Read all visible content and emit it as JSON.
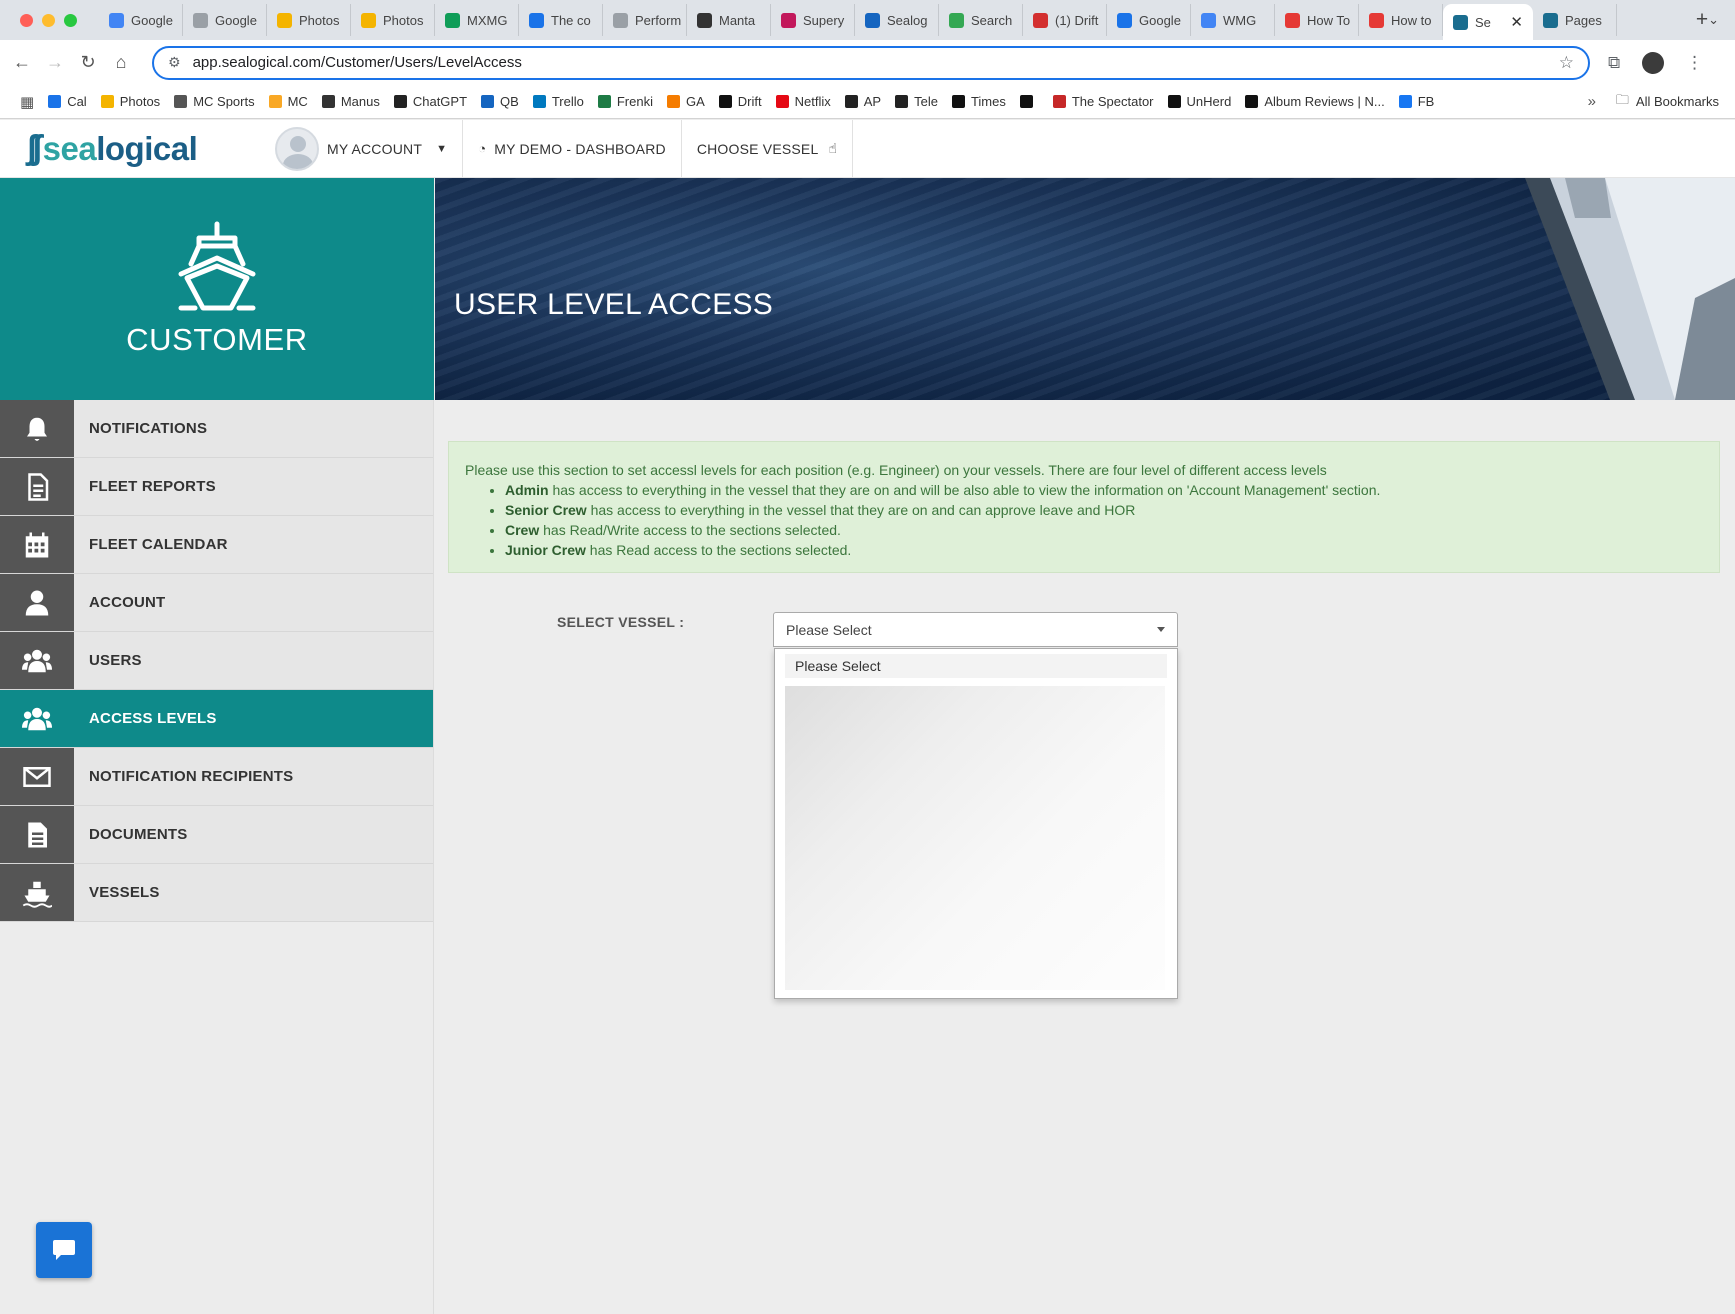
{
  "browser": {
    "tabs": [
      {
        "label": "Google",
        "color": "#4285f4"
      },
      {
        "label": "Google",
        "color": "#9aa0a6"
      },
      {
        "label": "Photos",
        "color": "#f4b400"
      },
      {
        "label": "Photos",
        "color": "#f4b400"
      },
      {
        "label": "MXMG",
        "color": "#0f9d58"
      },
      {
        "label": "The co",
        "color": "#1a73e8"
      },
      {
        "label": "Perform",
        "color": "#9aa0a6"
      },
      {
        "label": "Manta",
        "color": "#333333"
      },
      {
        "label": "Supery",
        "color": "#c2185b"
      },
      {
        "label": "Sealog",
        "color": "#1565c0"
      },
      {
        "label": "Search",
        "color": "#34a853"
      },
      {
        "label": "(1) Drift",
        "color": "#d32f2f"
      },
      {
        "label": "Google",
        "color": "#1a73e8"
      },
      {
        "label": "WMG",
        "color": "#4285f4"
      },
      {
        "label": "How To",
        "color": "#e53935"
      },
      {
        "label": "How to",
        "color": "#e53935"
      },
      {
        "label": "Se",
        "color": "#1a6d8f",
        "active": true
      },
      {
        "label": "Pages",
        "color": "#1a6d8f"
      }
    ],
    "url": "app.sealogical.com/Customer/Users/LevelAccess",
    "bookmarks": [
      {
        "label": "Cal",
        "color": "#1a73e8"
      },
      {
        "label": "Photos",
        "color": "#f4b400"
      },
      {
        "label": "MC Sports",
        "color": "#555555"
      },
      {
        "label": "MC",
        "color": "#f9a825"
      },
      {
        "label": "Manus",
        "color": "#333333"
      },
      {
        "label": "ChatGPT",
        "color": "#222222"
      },
      {
        "label": "QB",
        "color": "#1565c0"
      },
      {
        "label": "Trello",
        "color": "#0079bf"
      },
      {
        "label": "Frenki",
        "color": "#1e7b45"
      },
      {
        "label": "GA",
        "color": "#f57c00"
      },
      {
        "label": "Drift",
        "color": "#111111"
      },
      {
        "label": "Netflix",
        "color": "#e50914"
      },
      {
        "label": "AP",
        "color": "#222222"
      },
      {
        "label": "Tele",
        "color": "#222222"
      },
      {
        "label": "Times",
        "color": "#111111"
      },
      {
        "label": "",
        "color": "#111111"
      },
      {
        "label": "The Spectator",
        "color": "#c62828"
      },
      {
        "label": "UnHerd",
        "color": "#111111"
      },
      {
        "label": "Album Reviews | N...",
        "color": "#111111"
      },
      {
        "label": "FB",
        "color": "#1877f2"
      }
    ],
    "all_bookmarks": "All Bookmarks"
  },
  "header": {
    "logo_prefix": "sea",
    "logo_suffix": "logical",
    "my_account": "MY ACCOUNT",
    "dashboard": "MY DEMO - DASHBOARD",
    "choose_vessel": "CHOOSE VESSEL"
  },
  "sidebar": {
    "title": "CUSTOMER",
    "items": [
      {
        "label": "NOTIFICATIONS",
        "icon": "bell-icon"
      },
      {
        "label": "FLEET REPORTS",
        "icon": "document-icon"
      },
      {
        "label": "FLEET CALENDAR",
        "icon": "calendar-icon"
      },
      {
        "label": "ACCOUNT",
        "icon": "user-icon"
      },
      {
        "label": "USERS",
        "icon": "users-icon"
      },
      {
        "label": "ACCESS LEVELS",
        "icon": "users-icon",
        "active": true
      },
      {
        "label": "NOTIFICATION RECIPIENTS",
        "icon": "envelope-icon"
      },
      {
        "label": "DOCUMENTS",
        "icon": "file-icon"
      },
      {
        "label": "VESSELS",
        "icon": "ship-icon"
      }
    ]
  },
  "banner": {
    "title": "USER LEVEL ACCESS"
  },
  "info": {
    "intro": "Please use this section to set accessl levels for each position (e.g. Engineer) on your vessels. There are four level of different access levels",
    "levels": [
      {
        "name": "Admin",
        "desc": " has access to everything in the vessel that they are on and will be also able to view the information on 'Account Management' section."
      },
      {
        "name": "Senior Crew",
        "desc": " has access to everything in the vessel that they are on and can approve leave and HOR"
      },
      {
        "name": "Crew",
        "desc": " has Read/Write access to the sections selected."
      },
      {
        "name": "Junior Crew",
        "desc": " has Read access to the sections selected."
      }
    ]
  },
  "vessel_select": {
    "label": "SELECT VESSEL :",
    "value": "Please Select",
    "options": [
      "Please Select"
    ]
  }
}
